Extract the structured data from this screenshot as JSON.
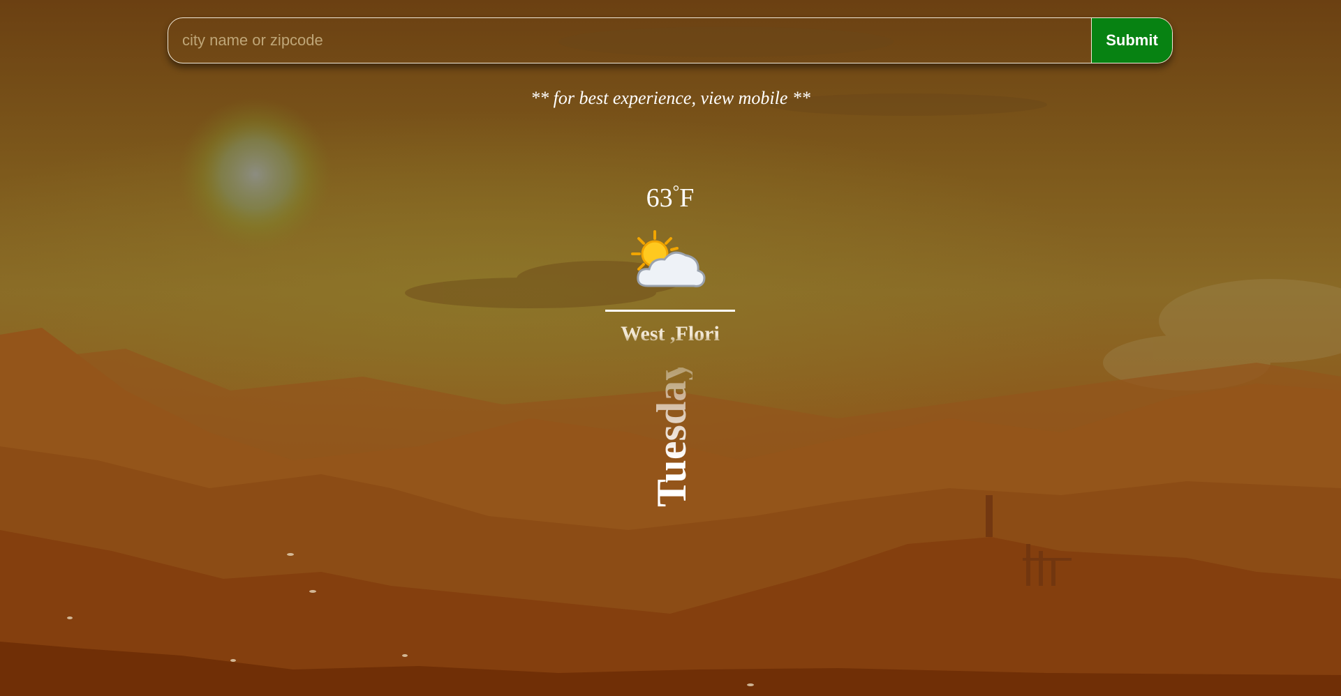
{
  "search": {
    "placeholder": "city name or zipcode",
    "submit_label": "Submit"
  },
  "hint": "** for best experience, view mobile **",
  "weather": {
    "temperature": "63",
    "degree_symbol": "°",
    "unit": "F",
    "icon": "partly-sunny-icon",
    "location": "West ,Flori",
    "day": "Tuesday"
  },
  "colors": {
    "submit_bg": "#078212",
    "sky_top": "#6b4012",
    "horizon": "#8a6a26",
    "ground": "#7a3b0d",
    "text": "#ffffff"
  }
}
